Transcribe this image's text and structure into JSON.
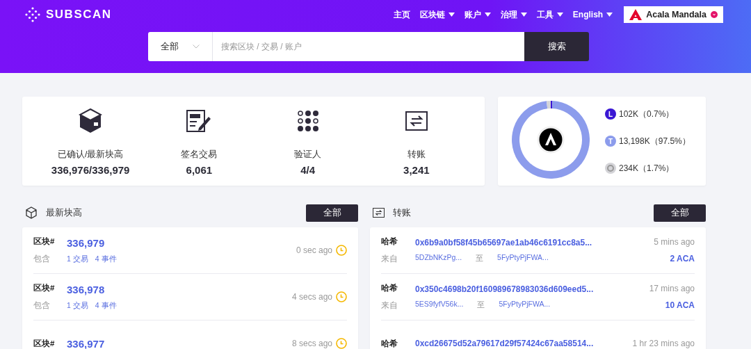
{
  "header": {
    "logo": "SUBSCAN",
    "nav": [
      {
        "label": "主页",
        "dropdown": false
      },
      {
        "label": "区块链",
        "dropdown": true
      },
      {
        "label": "账户",
        "dropdown": true
      },
      {
        "label": "治理",
        "dropdown": true
      },
      {
        "label": "工具",
        "dropdown": true
      },
      {
        "label": "English",
        "dropdown": true
      }
    ],
    "network": {
      "label": "Acala Mandala"
    },
    "search": {
      "filter": "全部",
      "placeholder": "搜索区块 / 交易 / 账户",
      "button": "搜索"
    }
  },
  "stats": [
    {
      "kind": "cube",
      "label": "已确认/最新块高",
      "value": "336,976/336,979"
    },
    {
      "kind": "document",
      "label": "签名交易",
      "value": "6,061"
    },
    {
      "kind": "dots",
      "label": "验证人",
      "value": "4/4"
    },
    {
      "kind": "transfer",
      "label": "转账",
      "value": "3,241"
    }
  ],
  "distribution": {
    "chart_data": {
      "type": "donut",
      "categories": [
        "102K（0.7%）",
        "13,198K（97.5%）",
        "234K（1.7%）"
      ],
      "series": [
        {
          "values": [
            0.7,
            97.5,
            1.7
          ]
        }
      ]
    },
    "legend": [
      {
        "badge": "L",
        "color": "#3a17d4"
      },
      {
        "badge": "T",
        "color": "#8c9cec"
      },
      {
        "color": "#d4d4d8"
      }
    ]
  },
  "blocks": {
    "title": "最新块高",
    "button": "全部",
    "rows": [
      {
        "label": "区块#",
        "number": "336,979",
        "includes_label": "包含",
        "extrinsics": "1 交易",
        "events": "4 事件",
        "time": "0 sec ago"
      },
      {
        "label": "区块#",
        "number": "336,978",
        "includes_label": "包含",
        "extrinsics": "1 交易",
        "events": "4 事件",
        "time": "4 secs ago"
      },
      {
        "label": "区块#",
        "number": "336,977",
        "time": "8 secs ago"
      }
    ]
  },
  "transfers": {
    "title": "转账",
    "button": "全部",
    "rows": [
      {
        "label": "哈希",
        "hash": "0x6b9a0bf58f45b65697ae1ab46c6191cc8a5...",
        "from_label": "来自",
        "from": "5DZbNKzPg...",
        "to_label": "至",
        "to": "5FyPtyPjFWA...",
        "amount": "2 ACA",
        "time": "5 mins ago"
      },
      {
        "label": "哈希",
        "hash": "0x350c4698b20f160989678983036d609eed5...",
        "from_label": "来自",
        "from": "5ES9fyfV56k...",
        "to_label": "至",
        "to": "5FyPtyPjFWA...",
        "amount": "10 ACA",
        "time": "17 mins ago"
      },
      {
        "label": "哈希",
        "hash": "0xcd26675d52a79617d29f57424c67aa58514...",
        "time": "1 hr 23 mins ago"
      }
    ]
  }
}
